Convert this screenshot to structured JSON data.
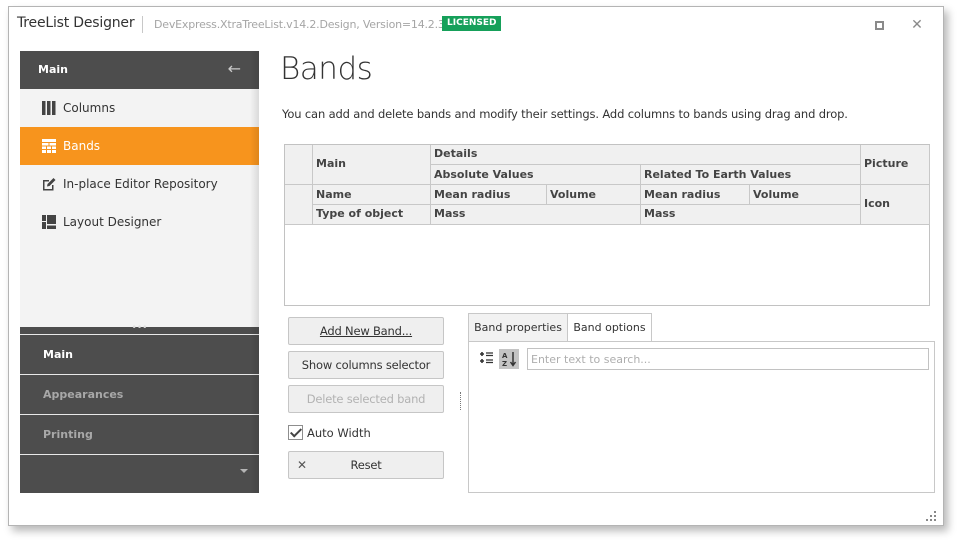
{
  "window": {
    "title": "TreeList Designer",
    "version": "DevExpress.XtraTreeList.v14.2.Design, Version=14.2.3.0",
    "badge": "LICENSED",
    "badge_color": "#16a05a",
    "controls": {
      "maximize": "maximize-icon",
      "close": "✕"
    }
  },
  "sidebar": {
    "header": "Main",
    "back_icon": "←",
    "items": [
      {
        "label": "Columns",
        "icon": "columns-icon",
        "active": false
      },
      {
        "label": "Bands",
        "icon": "bands-icon",
        "active": true
      },
      {
        "label": "In-place Editor Repository",
        "icon": "edit-icon",
        "active": false
      },
      {
        "label": "Layout Designer",
        "icon": "layout-icon",
        "active": false
      }
    ],
    "accent_color": "#f7941d",
    "splitter_dots": "•••",
    "groups": [
      {
        "label": "Main",
        "current": true
      },
      {
        "label": "Appearances",
        "current": false
      },
      {
        "label": "Printing",
        "current": false
      }
    ]
  },
  "main": {
    "title": "Bands",
    "description": "You can add and delete bands and modify their settings. Add columns to bands using drag and drop.",
    "band_grid": {
      "bands": {
        "main": "Main",
        "details": "Details",
        "absolute_values": "Absolute Values",
        "related_to_earth_values": "Related To Earth Values",
        "picture": "Picture"
      },
      "columns": {
        "name": "Name",
        "type_of_object": "Type of object",
        "abs_mean_radius": "Mean radius",
        "abs_volume": "Volume",
        "abs_mass": "Mass",
        "rel_mean_radius": "Mean radius",
        "rel_volume": "Volume",
        "rel_mass": "Mass",
        "icon": "Icon"
      }
    },
    "buttons": {
      "add_new_band": "Add New Band...",
      "show_columns_selector": "Show columns selector",
      "delete_selected_band": "Delete selected band",
      "reset": "Reset",
      "reset_icon": "✕"
    },
    "auto_width": {
      "label": "Auto Width",
      "checked": true
    },
    "tabs": [
      {
        "label": "Band properties",
        "active": true
      },
      {
        "label": "Band options",
        "active": false
      }
    ],
    "property_grid": {
      "search_placeholder": "Enter text to search...",
      "search_value": ""
    }
  }
}
